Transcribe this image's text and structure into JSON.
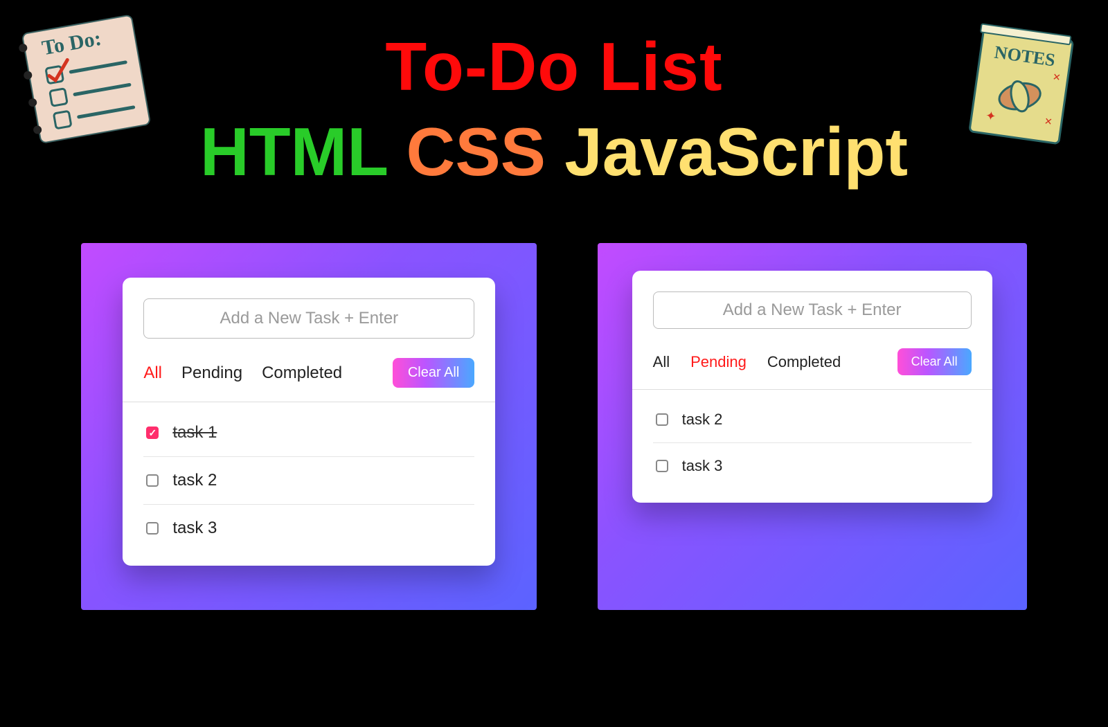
{
  "hero": {
    "title": "To-Do List",
    "sub": {
      "html": "HTML",
      "css": "CSS",
      "js": "JavaScript"
    }
  },
  "decor": {
    "todo_label": "To Do:",
    "notes_label": "NOTES"
  },
  "left": {
    "input_placeholder": "Add a New Task + Enter",
    "filters": {
      "all": "All",
      "pending": "Pending",
      "completed": "Completed"
    },
    "active_filter": "all",
    "clear_label": "Clear All",
    "tasks": [
      {
        "label": "task 1",
        "completed": true
      },
      {
        "label": "task 2",
        "completed": false
      },
      {
        "label": "task 3",
        "completed": false
      }
    ]
  },
  "right": {
    "input_placeholder": "Add a New Task + Enter",
    "filters": {
      "all": "All",
      "pending": "Pending",
      "completed": "Completed"
    },
    "active_filter": "pending",
    "clear_label": "Clear All",
    "tasks": [
      {
        "label": "task 2",
        "completed": false
      },
      {
        "label": "task 3",
        "completed": false
      }
    ]
  }
}
